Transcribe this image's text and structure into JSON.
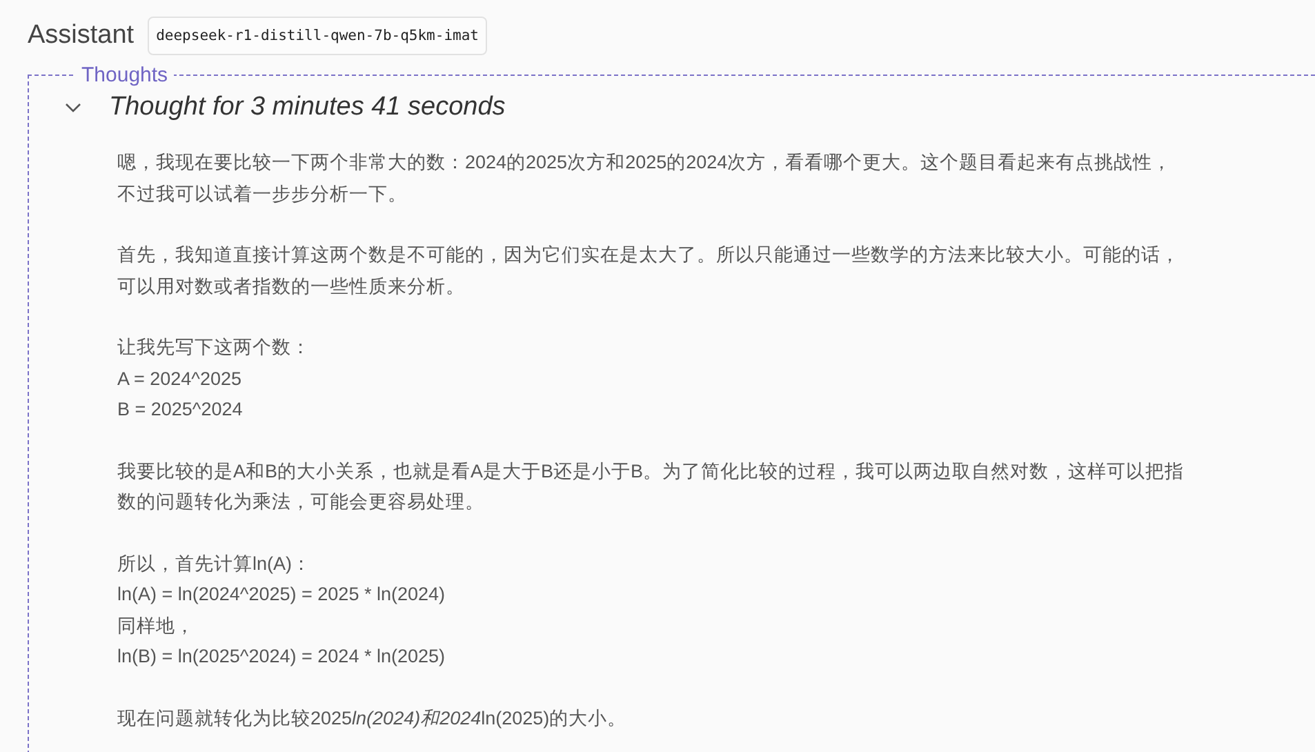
{
  "header": {
    "role": "Assistant",
    "model": "deepseek-r1-distill-qwen-7b-q5km-imat"
  },
  "thoughts": {
    "legend": "Thoughts",
    "expanded": true,
    "title": "Thought for 3 minutes 41 seconds",
    "paragraphs": [
      {
        "lines": [
          "嗯，我现在要比较一下两个非常大的数：2024的2025次方和2025的2024次方，看看哪个更大。这个题目看起来有点挑战性，",
          "不过我可以试着一步步分析一下。"
        ]
      },
      {
        "lines": [
          "首先，我知道直接计算这两个数是不可能的，因为它们实在是太大了。所以只能通过一些数学的方法来比较大小。可能的话，",
          "可以用对数或者指数的一些性质来分析。"
        ]
      },
      {
        "lines": [
          "让我先写下这两个数：",
          "A = 2024^2025",
          "B = 2025^2024"
        ]
      },
      {
        "lines": [
          "我要比较的是A和B的大小关系，也就是看A是大于B还是小于B。为了简化比较的过程，我可以两边取自然对数，这样可以把指",
          "数的问题转化为乘法，可能会更容易处理。"
        ]
      },
      {
        "lines": [
          "所以，首先计算ln(A)：",
          "ln(A) = ln(2024^2025) = 2025 * ln(2024)",
          "同样地，",
          "ln(B) = ln(2025^2024) = 2024 * ln(2025)"
        ]
      },
      {
        "lines": [
          {
            "parts": [
              {
                "text": "现在问题就转化为比较2025",
                "italic": false
              },
              {
                "text": "ln(2024)和2024",
                "italic": true
              },
              {
                "text": "ln(2025)的大小。",
                "italic": false
              }
            ]
          }
        ]
      }
    ]
  }
}
